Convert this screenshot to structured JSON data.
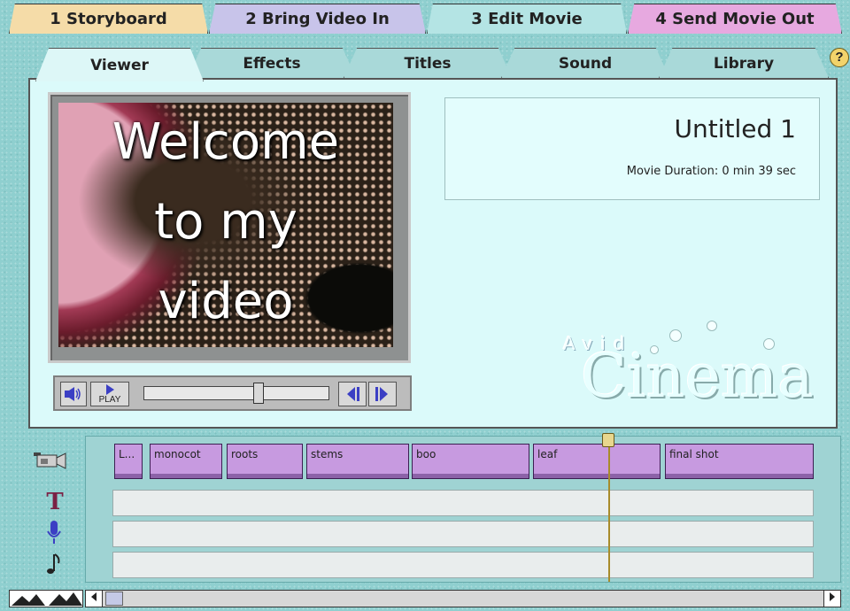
{
  "steps": [
    {
      "label": "1 Storyboard"
    },
    {
      "label": "2 Bring Video In"
    },
    {
      "label": "3 Edit Movie"
    },
    {
      "label": "4 Send Movie Out"
    }
  ],
  "subtabs": [
    {
      "label": "Viewer"
    },
    {
      "label": "Effects"
    },
    {
      "label": "Titles"
    },
    {
      "label": "Sound"
    },
    {
      "label": "Library"
    }
  ],
  "help": {
    "label": "?"
  },
  "viewer": {
    "title_lines": [
      "Welcome",
      "to my",
      "video"
    ],
    "play_label": "PLAY",
    "scrubber_position": 0.62
  },
  "movie": {
    "title": "Untitled 1",
    "duration": "Movie Duration: 0 min 39 sec"
  },
  "logo": {
    "line1": "Avid",
    "line2": "Cinema"
  },
  "timeline": {
    "video_clips": [
      {
        "label": "L..."
      },
      {
        "label": "monocot"
      },
      {
        "label": "roots"
      },
      {
        "label": "stems"
      },
      {
        "label": "boo"
      },
      {
        "label": "leaf"
      },
      {
        "label": "final shot"
      }
    ],
    "track_icons": [
      "camera-icon",
      "title-track-icon",
      "microphone-icon",
      "music-note-icon"
    ],
    "title_glyph": "T"
  },
  "colors": {
    "step1": "#f5dca8",
    "step2": "#c8c4ea",
    "step3": "#b4e4e4",
    "step4": "#e7a9e0",
    "clip": "#c79ae0",
    "panel": "#dbfafa"
  }
}
